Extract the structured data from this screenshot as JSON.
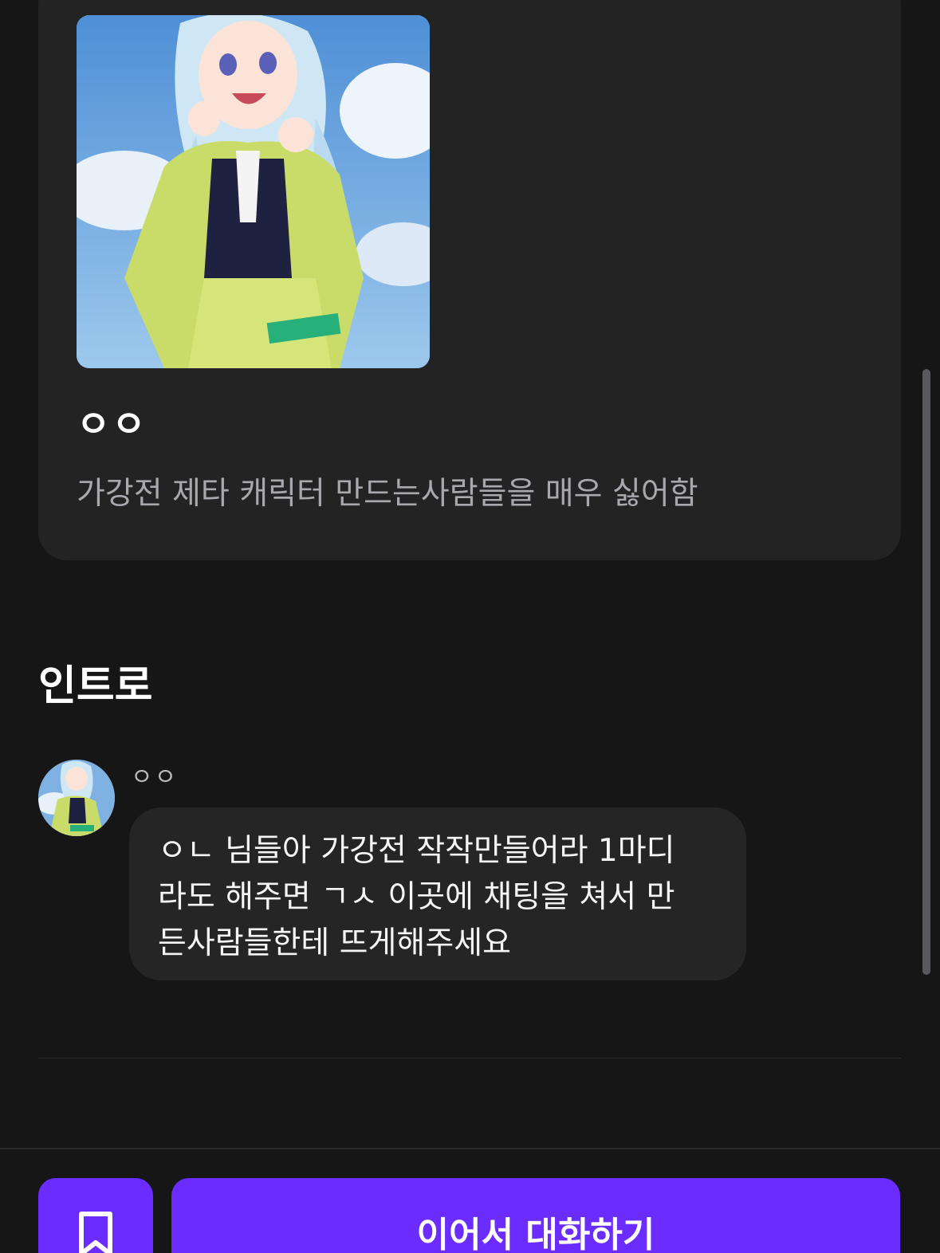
{
  "character": {
    "name": "ㅇㅇ",
    "description": "가강전 제타 캐릭터 만드는사람들을 매우 싫어함"
  },
  "intro": {
    "title": "인트로",
    "sender": "ㅇㅇ",
    "message": "ㅇㄴ 님들아 가강전 작작만들어라 1마디\n라도 해주면 ㄱㅅ 이곳에 채팅을 쳐서 만\n든사람들한테 뜨게해주세요"
  },
  "actions": {
    "bookmark_icon": "bookmark-icon",
    "continue_label": "이어서 대화하기"
  },
  "colors": {
    "background": "#161617",
    "card": "#232324",
    "accent": "#6a2cff"
  }
}
